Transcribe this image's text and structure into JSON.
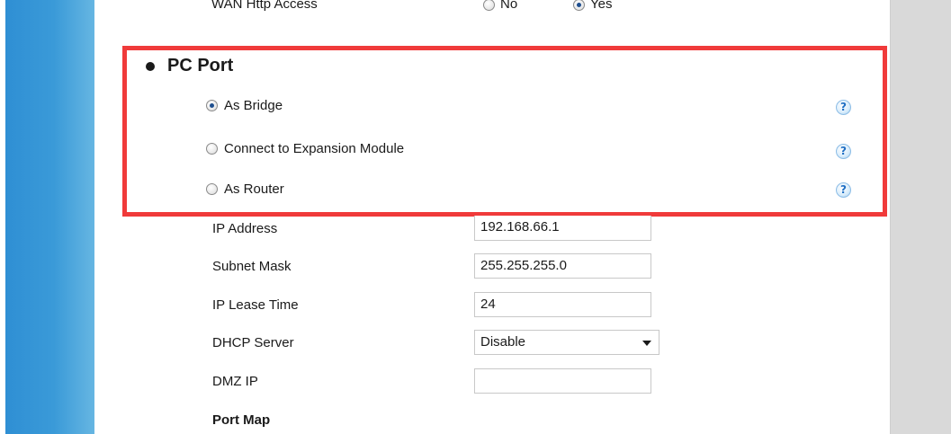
{
  "wan": {
    "label": "WAN Http Access",
    "options": [
      {
        "label": "No",
        "checked": false
      },
      {
        "label": "Yes",
        "checked": true
      }
    ]
  },
  "pc_port": {
    "title": "PC Port",
    "options": [
      {
        "label": "As Bridge",
        "checked": true
      },
      {
        "label": "Connect to Expansion Module",
        "checked": false
      },
      {
        "label": "As Router",
        "checked": false
      }
    ],
    "help_glyph": "?"
  },
  "fields": {
    "ip_address": {
      "label": "IP Address",
      "value": "192.168.66.1"
    },
    "subnet_mask": {
      "label": "Subnet Mask",
      "value": "255.255.255.0"
    },
    "ip_lease_time": {
      "label": "IP Lease Time",
      "value": "24"
    },
    "dhcp_server": {
      "label": "DHCP Server",
      "value": "Disable"
    },
    "dmz_ip": {
      "label": "DMZ IP",
      "value": ""
    }
  },
  "port_map": {
    "label": "Port Map"
  },
  "colors": {
    "highlight": "#f03a3a",
    "sidebar_blue": "#2f8fd4",
    "right_panel": "#d9d9d9"
  },
  "icons": {
    "help": "help-question-icon",
    "bullet": "bullet-dot-icon",
    "dropdown": "chevron-down-icon"
  }
}
